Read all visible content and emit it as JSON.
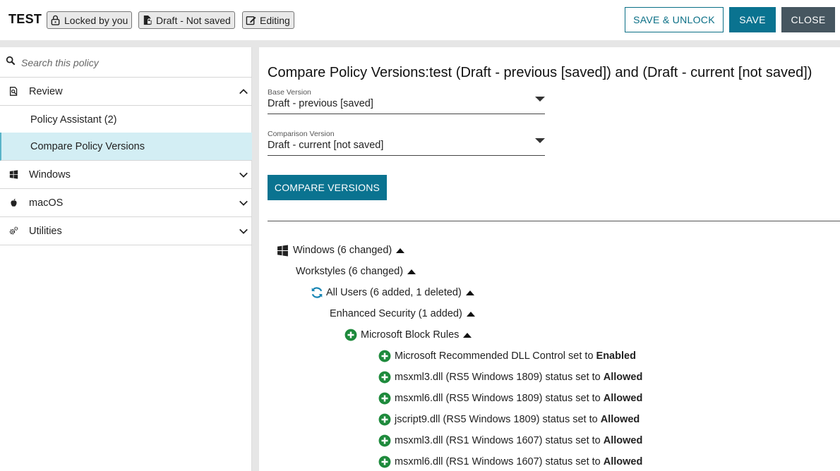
{
  "header": {
    "policy_name": "TEST",
    "badges": [
      {
        "label": "Locked by you",
        "icon": "lock-icon"
      },
      {
        "label": "Draft - Not saved",
        "icon": "file-lock-icon"
      },
      {
        "label": "Editing",
        "icon": "edit-icon"
      }
    ],
    "save_unlock_label": "SAVE & UNLOCK",
    "save_label": "SAVE",
    "close_label": "CLOSE"
  },
  "sidebar": {
    "search_placeholder": "Search this policy",
    "items": [
      {
        "label": "Review",
        "icon": "review-icon",
        "expanded": true,
        "children": [
          "Policy Assistant (2)",
          "Compare Policy Versions"
        ]
      },
      {
        "label": "Windows",
        "icon": "windows-icon",
        "expanded": false
      },
      {
        "label": "macOS",
        "icon": "apple-icon",
        "expanded": false
      },
      {
        "label": "Utilities",
        "icon": "gears-icon",
        "expanded": false
      }
    ],
    "active_child": "Compare Policy Versions"
  },
  "main": {
    "title": "Compare Policy Versions:test (Draft - previous [saved]) and (Draft - current [not saved])",
    "base_version": {
      "label": "Base Version",
      "value": "Draft - previous [saved]"
    },
    "comparison_version": {
      "label": "Comparison Version",
      "value": "Draft - current [not saved]"
    },
    "compare_button": "COMPARE VERSIONS",
    "tree": [
      {
        "text": "Windows (6 changed)",
        "icon": "windows-icon"
      },
      {
        "text": "Workstyles (6 changed)",
        "icon": ""
      },
      {
        "text": "All Users (6 added, 1 deleted)",
        "icon": "sync-icon"
      },
      {
        "text": "Enhanced Security (1 added)",
        "icon": ""
      },
      {
        "text": "Microsoft Block Rules",
        "icon": "plus-circle-icon"
      },
      {
        "text": "Microsoft Recommended DLL Control set to",
        "value": "Enabled",
        "icon": "plus-circle-icon"
      },
      {
        "text": "msxml3.dll (RS5 Windows 1809) status set to",
        "value": "Allowed",
        "icon": "plus-circle-icon"
      },
      {
        "text": "msxml6.dll (RS5 Windows 1809) status set to",
        "value": "Allowed",
        "icon": "plus-circle-icon"
      },
      {
        "text": "jscript9.dll (RS5 Windows 1809) status set to",
        "value": "Allowed",
        "icon": "plus-circle-icon"
      },
      {
        "text": "msxml3.dll (RS1 Windows 1607) status set to",
        "value": "Allowed",
        "icon": "plus-circle-icon"
      },
      {
        "text": "msxml6.dll (RS1 Windows 1607) status set to",
        "value": "Allowed",
        "icon": "plus-circle-icon"
      }
    ]
  },
  "colors": {
    "accent": "#0a7390",
    "close_button": "#465660",
    "active_nav": "#d3eef4",
    "added_green": "#1e8a3c",
    "sync_blue": "#1b87b5"
  }
}
